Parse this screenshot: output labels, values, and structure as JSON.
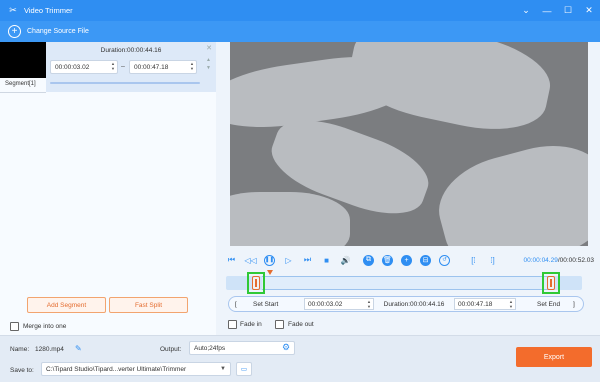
{
  "window": {
    "title": "Video Trimmer",
    "controls": [
      "chevron-down-icon",
      "minimize-icon",
      "maximize-icon",
      "close-icon"
    ]
  },
  "toolbar": {
    "change_source_label": "Change Source File"
  },
  "segment": {
    "duration_label": "Duration:00:00:44.16",
    "start_value": "00:00:03.02",
    "end_value": "00:00:47.18",
    "dash": "–",
    "label": "Segment[1]"
  },
  "left_actions": {
    "add_segment_label": "Add Segment",
    "fast_split_label": "Fast Split",
    "merge_label": "Merge into one"
  },
  "player": {
    "current_time": "00:00:04.29",
    "total_time": "/00:00:52.03"
  },
  "setbar": {
    "set_start_label": "Set Start",
    "start_value": "00:00:03.02",
    "duration_label": "Duration:00:00:44.16",
    "end_value": "00:00:47.18",
    "set_end_label": "Set End",
    "bracket_open": "[",
    "bracket_close": "]"
  },
  "fade": {
    "fade_in_label": "Fade in",
    "fade_out_label": "Fade out"
  },
  "bottom": {
    "name_label": "Name:",
    "name_value": "1280.mp4",
    "output_label": "Output:",
    "output_value": "Auto;24fps",
    "save_label": "Save to:",
    "save_value": "C:\\Tipard Studio\\Tipard...verter Ultimate\\Trimmer",
    "export_label": "Export"
  },
  "colors": {
    "accent": "#2f8ef2",
    "export": "#f36c2c",
    "highlight": "#2fc936"
  }
}
